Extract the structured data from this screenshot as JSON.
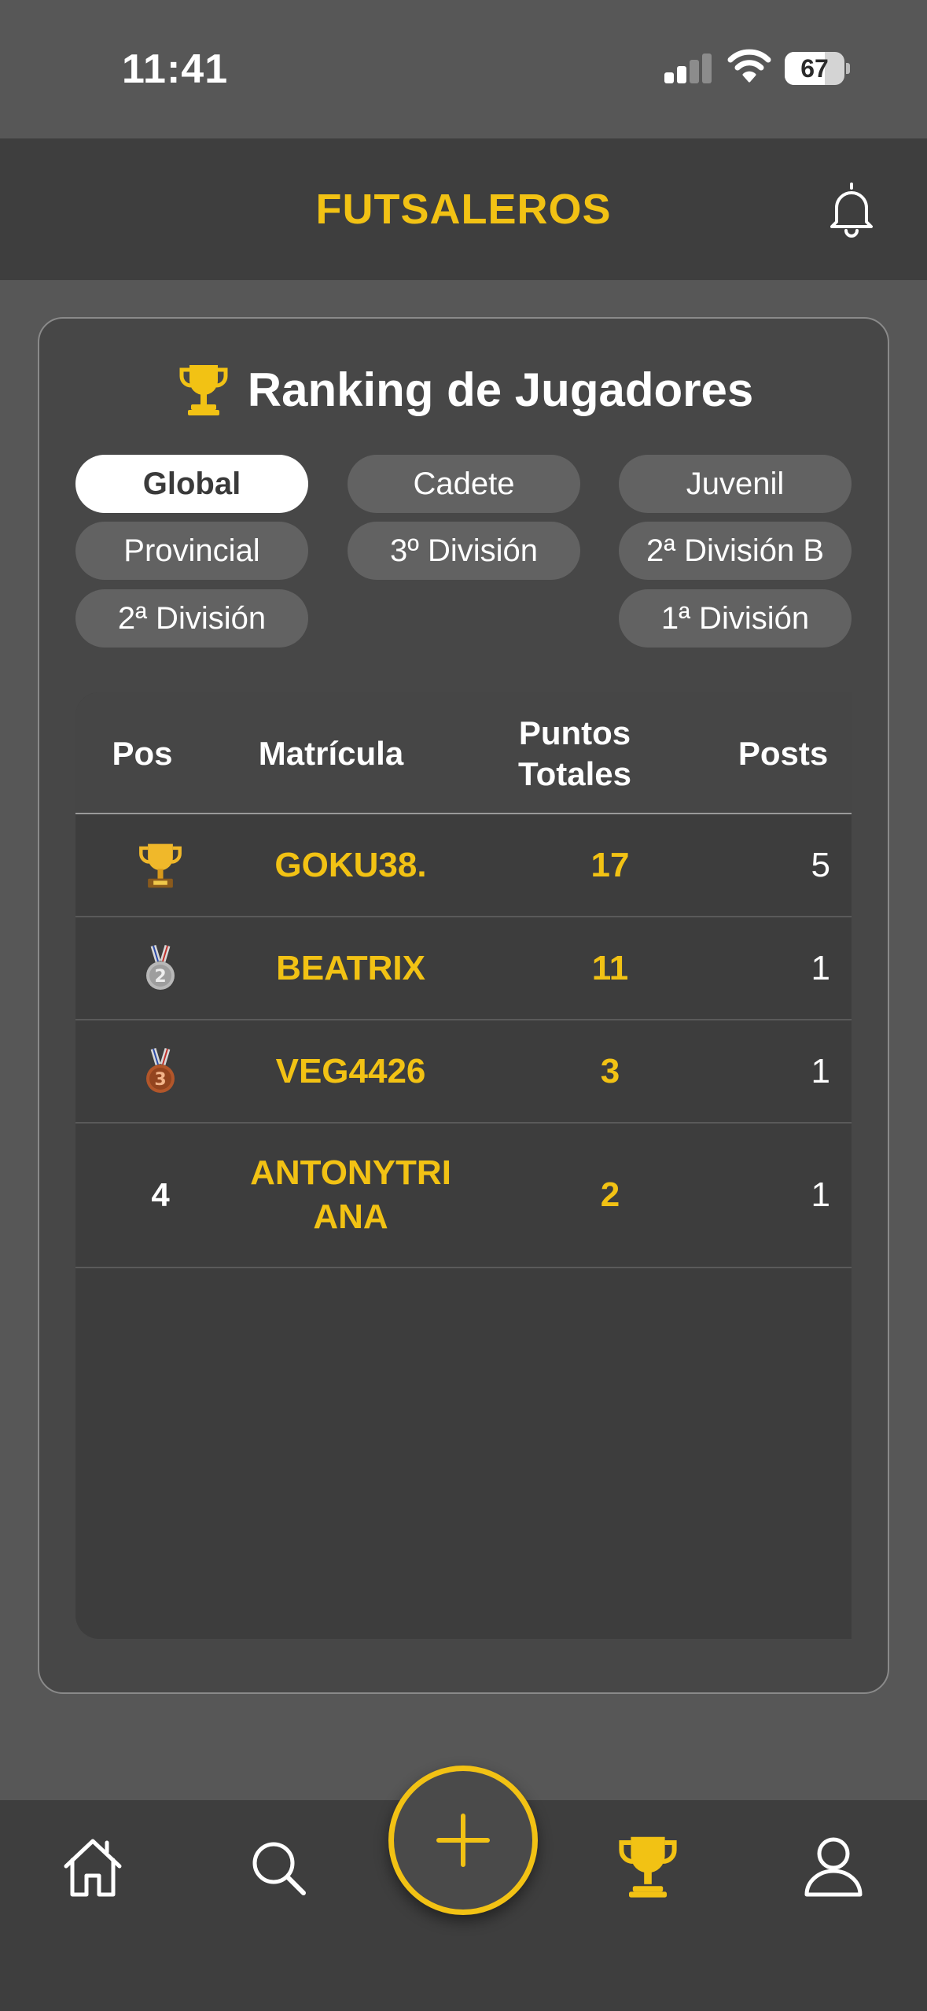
{
  "status_bar": {
    "time": "11:41",
    "battery_level": "67"
  },
  "header": {
    "title": "FUTSALEROS",
    "notification_icon": "bell-icon"
  },
  "ranking": {
    "title": "Ranking de Jugadores",
    "filters": [
      {
        "label": "Global",
        "active": true
      },
      {
        "label": "Cadete",
        "active": false
      },
      {
        "label": "Juvenil",
        "active": false
      },
      {
        "label": "Provincial",
        "active": false
      },
      {
        "label": "3º División",
        "active": false
      },
      {
        "label": "2ª División B",
        "active": false
      },
      {
        "label": "2ª División",
        "active": false
      },
      {
        "label": "1ª División",
        "active": false
      }
    ],
    "columns": {
      "pos": "Pos",
      "matricula": "Matrícula",
      "puntos": "Puntos Totales",
      "posts": "Posts"
    },
    "rows": [
      {
        "pos": "1",
        "pos_icon": "trophy-icon",
        "matricula": "GOKU38.",
        "puntos": "17",
        "posts": "5"
      },
      {
        "pos": "2",
        "pos_icon": "silver-medal-icon",
        "matricula": "BEATRIX",
        "puntos": "11",
        "posts": "1"
      },
      {
        "pos": "3",
        "pos_icon": "bronze-medal-icon",
        "matricula": "VEG4426",
        "puntos": "3",
        "posts": "1"
      },
      {
        "pos": "4",
        "pos_icon": "",
        "matricula": "ANTONYTRIANA",
        "puntos": "2",
        "posts": "1"
      }
    ]
  },
  "bottom_nav": {
    "items": [
      "home-icon",
      "search-icon",
      "add-icon",
      "trophy-icon",
      "profile-icon"
    ],
    "active": "trophy-icon"
  },
  "colors": {
    "accent": "#f2c214",
    "background": "#575757",
    "header": "#3e3e3e",
    "card": "#474747",
    "silver": "#b8b8b8",
    "bronze": "#b2562a"
  }
}
